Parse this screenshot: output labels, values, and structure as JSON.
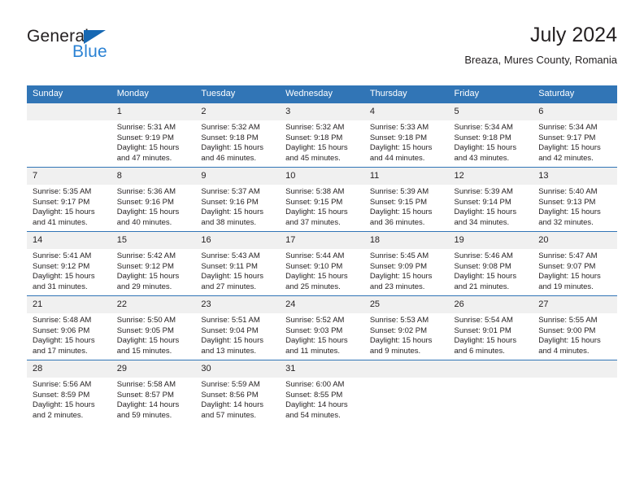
{
  "brand": {
    "name_part1": "General",
    "name_part2": "Blue",
    "triangle_color": "#1668b3",
    "blue_color": "#2a82d4"
  },
  "header": {
    "title": "July 2024",
    "subtitle": "Breaza, Mures County, Romania"
  },
  "theme": {
    "header_blue": "#3175b6",
    "daynum_band": "#f0f0f0",
    "text": "#231f20"
  },
  "weekday_headers": [
    "Sunday",
    "Monday",
    "Tuesday",
    "Wednesday",
    "Thursday",
    "Friday",
    "Saturday"
  ],
  "weeks": [
    [
      {
        "day": "",
        "sunrise": "",
        "sunset": "",
        "daylight1": "",
        "daylight2": ""
      },
      {
        "day": "1",
        "sunrise": "Sunrise: 5:31 AM",
        "sunset": "Sunset: 9:19 PM",
        "daylight1": "Daylight: 15 hours",
        "daylight2": "and 47 minutes."
      },
      {
        "day": "2",
        "sunrise": "Sunrise: 5:32 AM",
        "sunset": "Sunset: 9:18 PM",
        "daylight1": "Daylight: 15 hours",
        "daylight2": "and 46 minutes."
      },
      {
        "day": "3",
        "sunrise": "Sunrise: 5:32 AM",
        "sunset": "Sunset: 9:18 PM",
        "daylight1": "Daylight: 15 hours",
        "daylight2": "and 45 minutes."
      },
      {
        "day": "4",
        "sunrise": "Sunrise: 5:33 AM",
        "sunset": "Sunset: 9:18 PM",
        "daylight1": "Daylight: 15 hours",
        "daylight2": "and 44 minutes."
      },
      {
        "day": "5",
        "sunrise": "Sunrise: 5:34 AM",
        "sunset": "Sunset: 9:18 PM",
        "daylight1": "Daylight: 15 hours",
        "daylight2": "and 43 minutes."
      },
      {
        "day": "6",
        "sunrise": "Sunrise: 5:34 AM",
        "sunset": "Sunset: 9:17 PM",
        "daylight1": "Daylight: 15 hours",
        "daylight2": "and 42 minutes."
      }
    ],
    [
      {
        "day": "7",
        "sunrise": "Sunrise: 5:35 AM",
        "sunset": "Sunset: 9:17 PM",
        "daylight1": "Daylight: 15 hours",
        "daylight2": "and 41 minutes."
      },
      {
        "day": "8",
        "sunrise": "Sunrise: 5:36 AM",
        "sunset": "Sunset: 9:16 PM",
        "daylight1": "Daylight: 15 hours",
        "daylight2": "and 40 minutes."
      },
      {
        "day": "9",
        "sunrise": "Sunrise: 5:37 AM",
        "sunset": "Sunset: 9:16 PM",
        "daylight1": "Daylight: 15 hours",
        "daylight2": "and 38 minutes."
      },
      {
        "day": "10",
        "sunrise": "Sunrise: 5:38 AM",
        "sunset": "Sunset: 9:15 PM",
        "daylight1": "Daylight: 15 hours",
        "daylight2": "and 37 minutes."
      },
      {
        "day": "11",
        "sunrise": "Sunrise: 5:39 AM",
        "sunset": "Sunset: 9:15 PM",
        "daylight1": "Daylight: 15 hours",
        "daylight2": "and 36 minutes."
      },
      {
        "day": "12",
        "sunrise": "Sunrise: 5:39 AM",
        "sunset": "Sunset: 9:14 PM",
        "daylight1": "Daylight: 15 hours",
        "daylight2": "and 34 minutes."
      },
      {
        "day": "13",
        "sunrise": "Sunrise: 5:40 AM",
        "sunset": "Sunset: 9:13 PM",
        "daylight1": "Daylight: 15 hours",
        "daylight2": "and 32 minutes."
      }
    ],
    [
      {
        "day": "14",
        "sunrise": "Sunrise: 5:41 AM",
        "sunset": "Sunset: 9:12 PM",
        "daylight1": "Daylight: 15 hours",
        "daylight2": "and 31 minutes."
      },
      {
        "day": "15",
        "sunrise": "Sunrise: 5:42 AM",
        "sunset": "Sunset: 9:12 PM",
        "daylight1": "Daylight: 15 hours",
        "daylight2": "and 29 minutes."
      },
      {
        "day": "16",
        "sunrise": "Sunrise: 5:43 AM",
        "sunset": "Sunset: 9:11 PM",
        "daylight1": "Daylight: 15 hours",
        "daylight2": "and 27 minutes."
      },
      {
        "day": "17",
        "sunrise": "Sunrise: 5:44 AM",
        "sunset": "Sunset: 9:10 PM",
        "daylight1": "Daylight: 15 hours",
        "daylight2": "and 25 minutes."
      },
      {
        "day": "18",
        "sunrise": "Sunrise: 5:45 AM",
        "sunset": "Sunset: 9:09 PM",
        "daylight1": "Daylight: 15 hours",
        "daylight2": "and 23 minutes."
      },
      {
        "day": "19",
        "sunrise": "Sunrise: 5:46 AM",
        "sunset": "Sunset: 9:08 PM",
        "daylight1": "Daylight: 15 hours",
        "daylight2": "and 21 minutes."
      },
      {
        "day": "20",
        "sunrise": "Sunrise: 5:47 AM",
        "sunset": "Sunset: 9:07 PM",
        "daylight1": "Daylight: 15 hours",
        "daylight2": "and 19 minutes."
      }
    ],
    [
      {
        "day": "21",
        "sunrise": "Sunrise: 5:48 AM",
        "sunset": "Sunset: 9:06 PM",
        "daylight1": "Daylight: 15 hours",
        "daylight2": "and 17 minutes."
      },
      {
        "day": "22",
        "sunrise": "Sunrise: 5:50 AM",
        "sunset": "Sunset: 9:05 PM",
        "daylight1": "Daylight: 15 hours",
        "daylight2": "and 15 minutes."
      },
      {
        "day": "23",
        "sunrise": "Sunrise: 5:51 AM",
        "sunset": "Sunset: 9:04 PM",
        "daylight1": "Daylight: 15 hours",
        "daylight2": "and 13 minutes."
      },
      {
        "day": "24",
        "sunrise": "Sunrise: 5:52 AM",
        "sunset": "Sunset: 9:03 PM",
        "daylight1": "Daylight: 15 hours",
        "daylight2": "and 11 minutes."
      },
      {
        "day": "25",
        "sunrise": "Sunrise: 5:53 AM",
        "sunset": "Sunset: 9:02 PM",
        "daylight1": "Daylight: 15 hours",
        "daylight2": "and 9 minutes."
      },
      {
        "day": "26",
        "sunrise": "Sunrise: 5:54 AM",
        "sunset": "Sunset: 9:01 PM",
        "daylight1": "Daylight: 15 hours",
        "daylight2": "and 6 minutes."
      },
      {
        "day": "27",
        "sunrise": "Sunrise: 5:55 AM",
        "sunset": "Sunset: 9:00 PM",
        "daylight1": "Daylight: 15 hours",
        "daylight2": "and 4 minutes."
      }
    ],
    [
      {
        "day": "28",
        "sunrise": "Sunrise: 5:56 AM",
        "sunset": "Sunset: 8:59 PM",
        "daylight1": "Daylight: 15 hours",
        "daylight2": "and 2 minutes."
      },
      {
        "day": "29",
        "sunrise": "Sunrise: 5:58 AM",
        "sunset": "Sunset: 8:57 PM",
        "daylight1": "Daylight: 14 hours",
        "daylight2": "and 59 minutes."
      },
      {
        "day": "30",
        "sunrise": "Sunrise: 5:59 AM",
        "sunset": "Sunset: 8:56 PM",
        "daylight1": "Daylight: 14 hours",
        "daylight2": "and 57 minutes."
      },
      {
        "day": "31",
        "sunrise": "Sunrise: 6:00 AM",
        "sunset": "Sunset: 8:55 PM",
        "daylight1": "Daylight: 14 hours",
        "daylight2": "and 54 minutes."
      },
      {
        "day": "",
        "sunrise": "",
        "sunset": "",
        "daylight1": "",
        "daylight2": ""
      },
      {
        "day": "",
        "sunrise": "",
        "sunset": "",
        "daylight1": "",
        "daylight2": ""
      },
      {
        "day": "",
        "sunrise": "",
        "sunset": "",
        "daylight1": "",
        "daylight2": ""
      }
    ]
  ]
}
